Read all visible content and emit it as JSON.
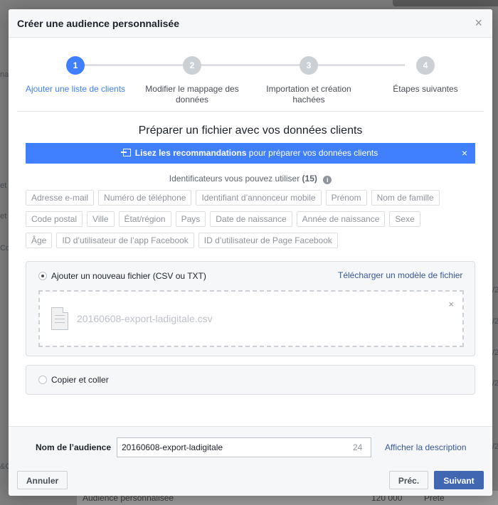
{
  "background": {
    "frag_left": [
      "na",
      "et",
      "et",
      "Co",
      "&C"
    ],
    "frag_right": [
      "/2",
      "/2",
      "/2",
      "/2",
      "/2"
    ],
    "bottom_row": {
      "label": "Audience personnalisée",
      "count": "120 000",
      "status": "Prête"
    }
  },
  "modal": {
    "title": "Créer une audience personnalisée",
    "close_symbol": "×"
  },
  "stepper": {
    "steps": [
      {
        "number": "1",
        "label": "Ajouter une liste de clients",
        "active": true
      },
      {
        "number": "2",
        "label": "Modifier le mappage des données",
        "active": false
      },
      {
        "number": "3",
        "label": "Importation et création hachées",
        "active": false
      },
      {
        "number": "4",
        "label": "Étapes suivantes",
        "active": false
      }
    ]
  },
  "section_title": "Préparer un fichier avec vos données clients",
  "banner": {
    "link_text": "Lisez les recommandations",
    "rest_text": " pour préparer vos données clients",
    "close_symbol": "×"
  },
  "identifiers": {
    "title": "Identificateurs vous pouvez utiliser",
    "count": "(15)",
    "info_symbol": "i",
    "rows": [
      [
        "Adresse e-mail",
        "Numéro de téléphone",
        "Identifiant d’annonceur mobile",
        "Prénom",
        "Nom de famille"
      ],
      [
        "Code postal",
        "Ville",
        "État/région",
        "Pays",
        "Date de naissance",
        "Année de naissance",
        "Sexe"
      ],
      [
        "Âge",
        "ID d’utilisateur de l’app Facebook",
        "ID d’utilisateur de Page Facebook"
      ]
    ]
  },
  "upload": {
    "option_label": "Ajouter un nouveau fichier (CSV ou TXT)",
    "template_link": "Télécharger un modèle de fichier",
    "file_name": "20160608-export-ladigitale.csv",
    "remove_symbol": "×"
  },
  "paste": {
    "option_label": "Copier et coller"
  },
  "footer": {
    "name_label": "Nom de l’audience",
    "name_value": "20160608-export-ladigitale",
    "char_count": "24",
    "desc_link": "Afficher la description",
    "cancel_label": "Annuler",
    "prev_label": "Préc.",
    "next_label": "Suivant"
  }
}
